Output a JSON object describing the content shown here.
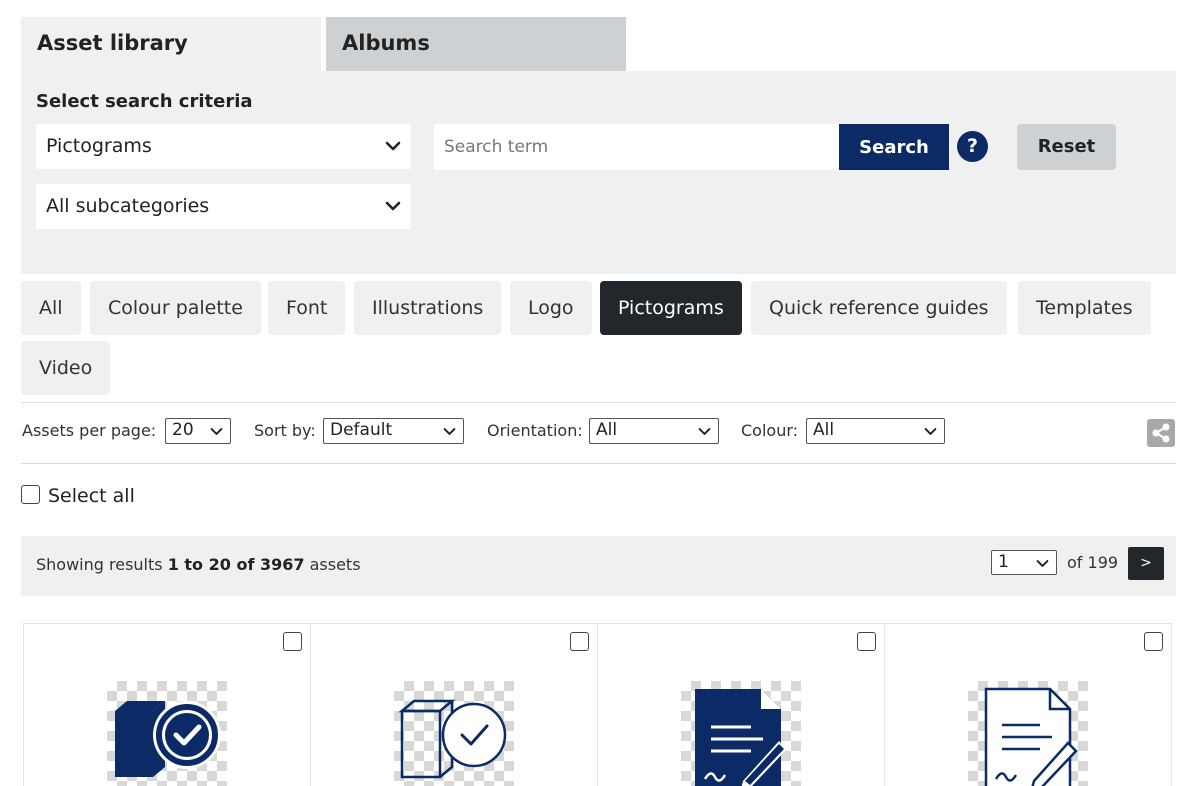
{
  "tabs": {
    "asset_library": "Asset library",
    "albums": "Albums"
  },
  "search": {
    "criteria_label": "Select search criteria",
    "category_value": "Pictograms",
    "subcategory_value": "All subcategories",
    "placeholder": "Search term",
    "search_label": "Search",
    "help_label": "?",
    "reset_label": "Reset"
  },
  "categories": [
    {
      "label": "All",
      "active": false
    },
    {
      "label": "Colour palette",
      "active": false
    },
    {
      "label": "Font",
      "active": false
    },
    {
      "label": "Illustrations",
      "active": false
    },
    {
      "label": "Logo",
      "active": false
    },
    {
      "label": "Pictograms",
      "active": true
    },
    {
      "label": "Quick reference guides",
      "active": false
    },
    {
      "label": "Templates",
      "active": false
    },
    {
      "label": "Video",
      "active": false
    }
  ],
  "filters": {
    "per_page_label": "Assets per page:",
    "per_page_value": "20",
    "sort_label": "Sort by:",
    "sort_value": "Default",
    "orientation_label": "Orientation:",
    "orientation_value": "All",
    "colour_label": "Colour:",
    "colour_value": "All",
    "share_icon": "share-icon"
  },
  "select_all_label": "Select all",
  "results": {
    "prefix": "Showing results",
    "range": "1 to 20 of 3967",
    "suffix": "assets",
    "page_value": "1",
    "page_of": "of 199",
    "next_label": ">"
  },
  "assets": [
    {
      "icon": "box-check-filled-icon"
    },
    {
      "icon": "box-check-outline-icon"
    },
    {
      "icon": "document-sign-filled-icon"
    },
    {
      "icon": "document-sign-outline-icon"
    }
  ],
  "colors": {
    "brand_navy": "#0b2a66",
    "active_dark": "#22272b",
    "panel_grey": "#f0f0f0",
    "tab_inactive": "#cdd1d4"
  }
}
